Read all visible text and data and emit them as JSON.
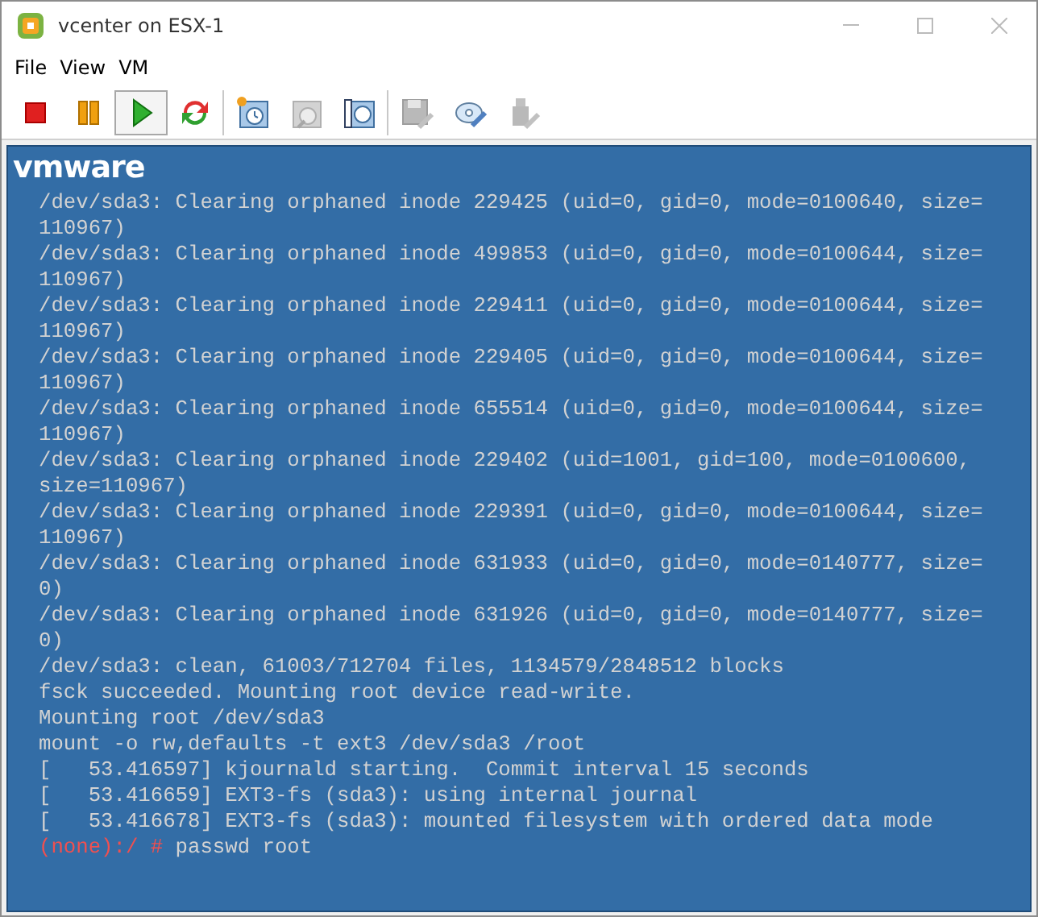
{
  "window": {
    "title": "vcenter on ESX-1"
  },
  "menu": [
    {
      "label": "File"
    },
    {
      "label": "View"
    },
    {
      "label": "VM"
    }
  ],
  "toolbar": [
    {
      "kind": "stop",
      "disabled": false,
      "selected": false
    },
    {
      "kind": "pause",
      "disabled": false,
      "selected": false
    },
    {
      "kind": "play",
      "disabled": false,
      "selected": true
    },
    {
      "kind": "reset",
      "disabled": false,
      "selected": false
    },
    {
      "kind": "separator"
    },
    {
      "kind": "snapshot",
      "disabled": false,
      "selected": false
    },
    {
      "kind": "revert",
      "disabled": true,
      "selected": false
    },
    {
      "kind": "manage",
      "disabled": false,
      "selected": false
    },
    {
      "kind": "separator"
    },
    {
      "kind": "floppy",
      "disabled": true,
      "selected": false
    },
    {
      "kind": "cd",
      "disabled": false,
      "selected": false
    },
    {
      "kind": "usb",
      "disabled": true,
      "selected": false
    }
  ],
  "console": {
    "logo": "vmware",
    "lines": [
      {
        "kind": "output",
        "text": "/dev/sda3: Clearing orphaned inode 229425 (uid=0, gid=0, mode=0100640, size="
      },
      {
        "kind": "output",
        "text": "110967)"
      },
      {
        "kind": "output",
        "text": "/dev/sda3: Clearing orphaned inode 499853 (uid=0, gid=0, mode=0100644, size="
      },
      {
        "kind": "output",
        "text": "110967)"
      },
      {
        "kind": "output",
        "text": "/dev/sda3: Clearing orphaned inode 229411 (uid=0, gid=0, mode=0100644, size="
      },
      {
        "kind": "output",
        "text": "110967)"
      },
      {
        "kind": "output",
        "text": "/dev/sda3: Clearing orphaned inode 229405 (uid=0, gid=0, mode=0100644, size="
      },
      {
        "kind": "output",
        "text": "110967)"
      },
      {
        "kind": "output",
        "text": "/dev/sda3: Clearing orphaned inode 655514 (uid=0, gid=0, mode=0100644, size="
      },
      {
        "kind": "output",
        "text": "110967)"
      },
      {
        "kind": "output",
        "text": "/dev/sda3: Clearing orphaned inode 229402 (uid=1001, gid=100, mode=0100600,"
      },
      {
        "kind": "output",
        "text": "size=110967)"
      },
      {
        "kind": "output",
        "text": "/dev/sda3: Clearing orphaned inode 229391 (uid=0, gid=0, mode=0100644, size="
      },
      {
        "kind": "output",
        "text": "110967)"
      },
      {
        "kind": "output",
        "text": "/dev/sda3: Clearing orphaned inode 631933 (uid=0, gid=0, mode=0140777, size="
      },
      {
        "kind": "output",
        "text": "0)"
      },
      {
        "kind": "output",
        "text": "/dev/sda3: Clearing orphaned inode 631926 (uid=0, gid=0, mode=0140777, size="
      },
      {
        "kind": "output",
        "text": "0)"
      },
      {
        "kind": "output",
        "text": "/dev/sda3: clean, 61003/712704 files, 1134579/2848512 blocks"
      },
      {
        "kind": "output",
        "text": "fsck succeeded. Mounting root device read-write."
      },
      {
        "kind": "output",
        "text": "Mounting root /dev/sda3"
      },
      {
        "kind": "output",
        "text": "mount -o rw,defaults -t ext3 /dev/sda3 /root"
      },
      {
        "kind": "output",
        "text": "[   53.416597] kjournald starting.  Commit interval 15 seconds"
      },
      {
        "kind": "output",
        "text": "[   53.416659] EXT3-fs (sda3): using internal journal"
      },
      {
        "kind": "output",
        "text": "[   53.416678] EXT3-fs (sda3): mounted filesystem with ordered data mode"
      },
      {
        "kind": "prompt",
        "prompt": "(none):/ #",
        "text": "passwd root"
      }
    ]
  }
}
